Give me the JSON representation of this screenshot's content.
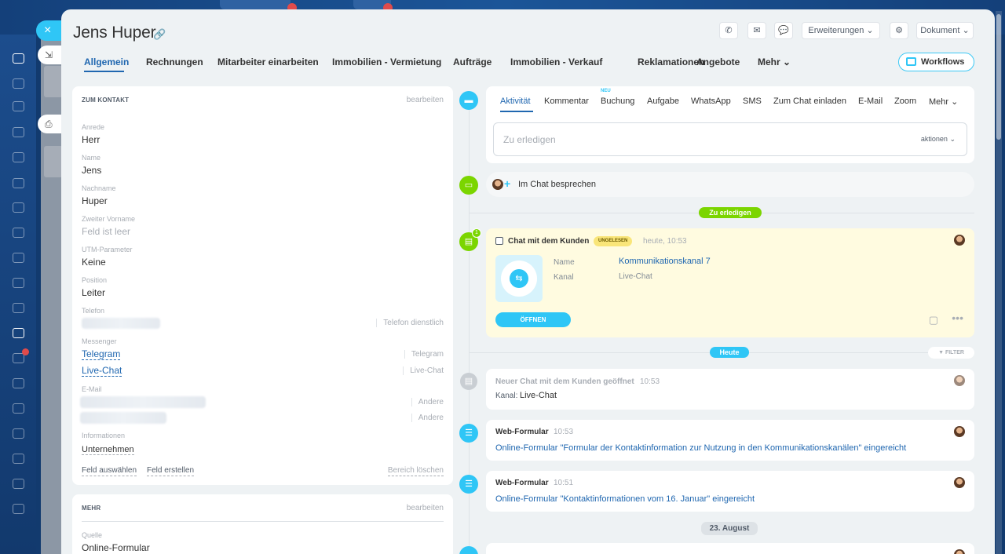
{
  "window": {
    "close_glyph": "×"
  },
  "header": {
    "title": "Jens Huper"
  },
  "toolbar": {
    "extensions_label": "Erweiterungen",
    "document_label": "Dokument",
    "workflows_label": "Workflows"
  },
  "tabs": [
    {
      "label": "Allgemein"
    },
    {
      "label": "Rechnungen"
    },
    {
      "label": "Mitarbeiter einarbeiten"
    },
    {
      "label": "Immobilien - Vermietung"
    },
    {
      "label": "Aufträge"
    },
    {
      "label": "Immobilien - Verkauf"
    },
    {
      "label": "Reklamationen"
    },
    {
      "label": "Angebote"
    },
    {
      "label": "Mehr"
    }
  ],
  "contact": {
    "section_title": "ZUM KONTAKT",
    "edit_label": "bearbeiten",
    "fields": [
      {
        "label": "Anrede",
        "value": "Herr"
      },
      {
        "label": "Name",
        "value": "Jens"
      },
      {
        "label": "Nachname",
        "value": "Huper"
      },
      {
        "label": "Zweiter Vorname",
        "value": "Feld ist leer"
      },
      {
        "label": "UTM-Parameter",
        "value": "Keine"
      },
      {
        "label": "Position",
        "value": "Leiter"
      }
    ],
    "phone": {
      "label": "Telefon",
      "type": "Telefon dienstlich"
    },
    "messenger": {
      "label": "Messenger",
      "items": [
        {
          "value": "Telegram",
          "type": "Telegram"
        },
        {
          "value": "Live-Chat",
          "type": "Live-Chat"
        }
      ]
    },
    "email": {
      "label": "E-Mail",
      "types": [
        "Andere",
        "Andere"
      ]
    },
    "info": {
      "label": "Informationen",
      "value": "Unternehmen"
    },
    "select_field": "Feld auswählen",
    "create_field": "Feld erstellen",
    "clear_section": "Bereich löschen"
  },
  "more": {
    "section_title": "MEHR",
    "edit_label": "bearbeiten",
    "source_label": "Quelle",
    "source_value": "Online-Formular"
  },
  "activity": {
    "new_badge": "NEU",
    "tabs": [
      "Aktivität",
      "Kommentar",
      "Buchung",
      "Aufgabe",
      "WhatsApp",
      "SMS",
      "Zum Chat einladen",
      "E-Mail",
      "Zoom",
      "Mehr"
    ],
    "todo_placeholder": "Zu erledigen",
    "todo_actions": "aktionen",
    "chat_discuss": "Im Chat besprechen"
  },
  "timeline": {
    "todo_pill": "Zu erledigen",
    "today_pill": "Heute",
    "filter_label": "FILTER",
    "date_pill": "23. August",
    "chat_item": {
      "title": "Chat mit dem Kunden",
      "badge": "UNGELESEN",
      "time": "heute, 10:53",
      "name_label": "Name",
      "name_value": "Kommunikationskanal 7",
      "channel_label": "Kanal",
      "channel_value": "Live-Chat",
      "open_button": "ÖFFNEN",
      "count": "1"
    },
    "items": [
      {
        "title": "Neuer Chat mit dem Kunden geöffnet",
        "time": "10:53",
        "detail_label": "Kanal:",
        "detail_value": "Live-Chat"
      },
      {
        "title": "Web-Formular",
        "time": "10:53",
        "text": "Online-Formular \"Formular der Kontaktinformation zur Nutzung in den Kommunikationskanälen\" eingereicht"
      },
      {
        "title": "Web-Formular",
        "time": "10:51",
        "text": "Online-Formular \"Kontaktinformationen vom 16. Januar\" eingereicht"
      }
    ]
  },
  "colors": {
    "accent": "#2067b0",
    "cyan": "#2fc6f6",
    "green": "#7bd500",
    "highlight": "#fffbe0"
  }
}
